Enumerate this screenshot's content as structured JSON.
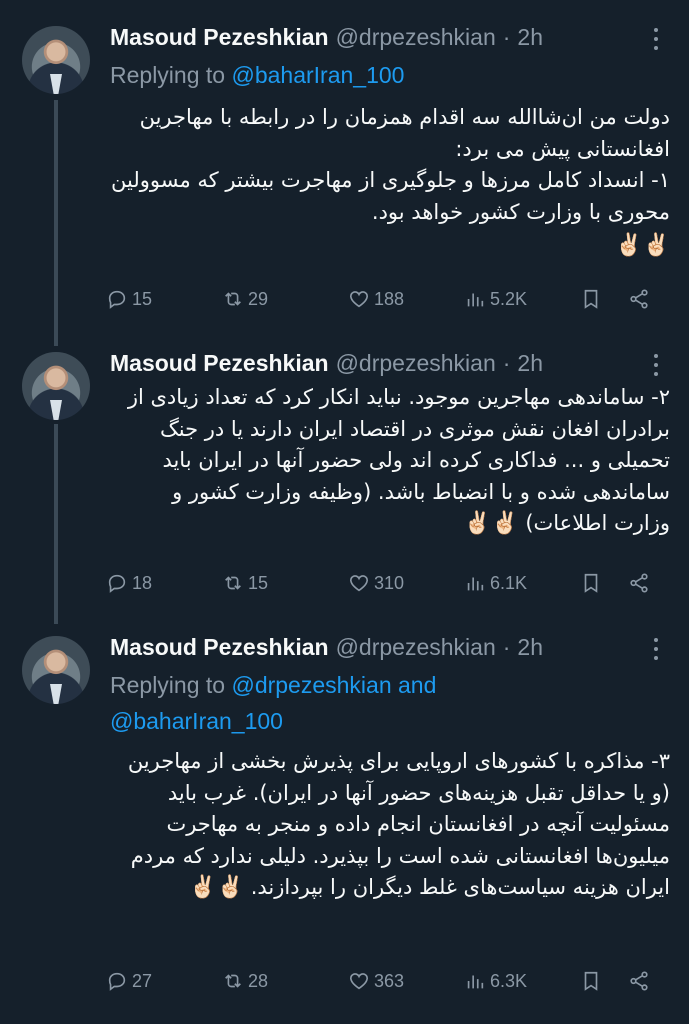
{
  "author": {
    "name": "Masoud Pezeshkian",
    "handle": "@drpezeshkian",
    "separator": "·",
    "time": "2h"
  },
  "tweets": [
    {
      "reply_prefix": "Replying to",
      "reply_mentions": "@baharIran_100",
      "text": "دولت من ان‌شاالله سه اقدام همزمان را در رابطه با مهاجرین افغانستانی پیش می برد:\n۱- انسداد کامل مرزها و جلوگیری از مهاجرت بیشتر که مسوولین محوری با وزارت کشور خواهد بود.",
      "emoji": "✌🏻✌🏻",
      "stats": {
        "replies": "15",
        "reposts": "29",
        "likes": "188",
        "views": "5.2K"
      }
    },
    {
      "text": "۲- ساماندهی مهاجرین موجود. نباید انکار کرد که تعداد زیادی از برادران افغان نقش موثری در اقتصاد ایران دارند یا در جنگ تحمیلی و ... فداکاری کرده اند ولی حضور آنها در ایران باید ساماندهی شده و با انضباط باشد. (وظیفه وزارت کشور و وزارت اطلاعات)",
      "emoji": "✌🏻✌🏻",
      "stats": {
        "replies": "18",
        "reposts": "15",
        "likes": "310",
        "views": "6.1K"
      }
    },
    {
      "reply_prefix": "Replying to",
      "reply_mentions": "@drpezeshkian and",
      "reply_mentions_2": "@baharIran_100",
      "text": "۳- مذاکره با کشورهای اروپایی برای پذیرش بخشی از مهاجرین (و یا حداقل تقبل هزینه‌های حضور آنها در ایران). غرب باید مسئولیت آنچه در افغانستان انجام داده و منجر به مهاجرت میلیون‌ها افغانستانی شده است را بپذیرد. دلیلی ندارد که مردم ایران هزینه سیاست‌های غلط دیگران را بپردازند.",
      "emoji": "✌🏻✌🏻",
      "stats": {
        "replies": "27",
        "reposts": "28",
        "likes": "363",
        "views": "6.3K"
      }
    }
  ]
}
